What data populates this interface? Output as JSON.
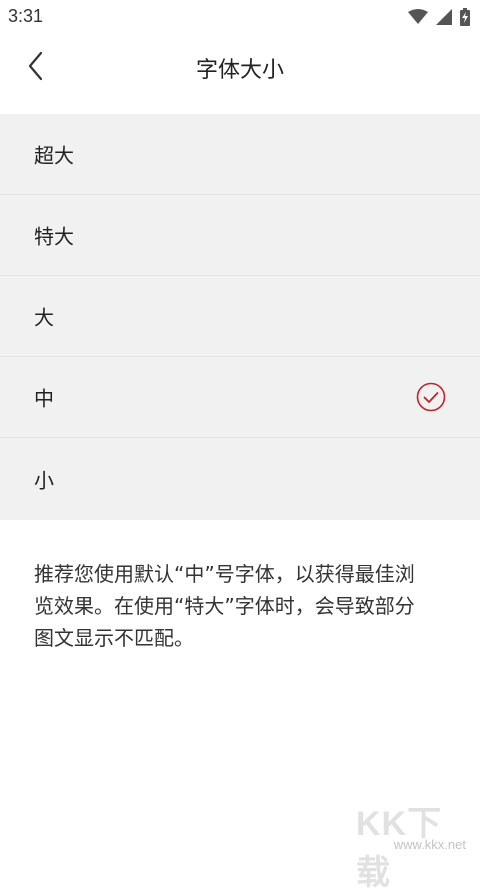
{
  "status_bar": {
    "time": "3:31",
    "icons": [
      "wifi-icon",
      "cellular-signal-icon",
      "battery-charging-icon"
    ]
  },
  "app_bar": {
    "back_icon": "chevron-left-icon",
    "title": "字体大小"
  },
  "font_options": [
    {
      "label": "超大",
      "selected": false
    },
    {
      "label": "特大",
      "selected": false
    },
    {
      "label": "大",
      "selected": false
    },
    {
      "label": "中",
      "selected": true
    },
    {
      "label": "小",
      "selected": false
    }
  ],
  "hint": {
    "line1": "推荐您使用默认“中”号字体，以获得最佳浏",
    "line2": "览效果。在使用“特大”字体时，会导致部分",
    "line3": "图文显示不匹配。"
  },
  "watermark": {
    "logo": "KK下载",
    "url": "www.kkx.net"
  },
  "colors": {
    "accent": "#c0242b",
    "list_background": "#f1f1f1",
    "divider": "#e3e3e3"
  }
}
